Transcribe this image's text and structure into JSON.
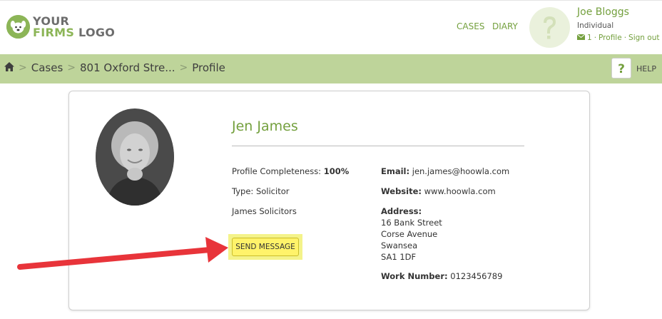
{
  "header": {
    "logo": {
      "line1": "YOUR",
      "line2a": "FIRMS",
      "line2b": "LOGO"
    },
    "nav": [
      {
        "label": "CASES"
      },
      {
        "label": "DIARY"
      }
    ],
    "user": {
      "name": "Joe Bloggs",
      "type": "Individual",
      "message_count": "1",
      "profile_link": "Profile",
      "separator": "·",
      "signout_link": "Sign out"
    }
  },
  "breadcrumb": {
    "items": [
      "Cases",
      "801 Oxford Stre...",
      "Profile"
    ],
    "separator": ">"
  },
  "help": {
    "label": "HELP",
    "icon_glyph": "?"
  },
  "profile": {
    "name": "Jen James",
    "completeness_label": "Profile Completeness:",
    "completeness_value": "100%",
    "type_line": "Type: Solicitor",
    "firm": "James Solicitors",
    "send_button": "SEND MESSAGE",
    "email_label": "Email:",
    "email_value": "jen.james@hoowla.com",
    "website_label": "Website:",
    "website_value": "www.hoowla.com",
    "address_label": "Address:",
    "address_lines": [
      "16 Bank Street",
      "Corse Avenue",
      "Swansea",
      "SA1 1DF"
    ],
    "work_label": "Work Number:",
    "work_value": "0123456789"
  },
  "colors": {
    "accent_green": "#74a03e",
    "crumb_bar": "#bed49a",
    "highlight_yellow": "#fff36a",
    "arrow_red": "#e8343a"
  },
  "icons": [
    "logo-dog-icon",
    "user-placeholder-icon",
    "envelope-icon",
    "home-icon",
    "help-icon",
    "pointer-arrow"
  ]
}
